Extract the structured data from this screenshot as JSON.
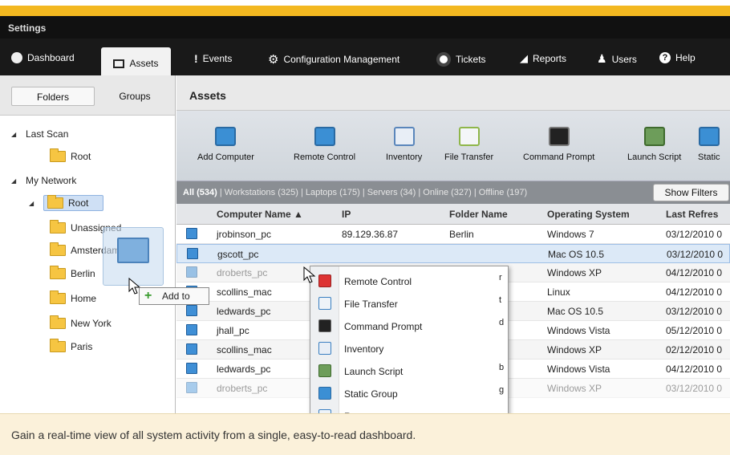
{
  "window": {
    "title": "Settings"
  },
  "nav": {
    "items": [
      {
        "label": "Dashboard",
        "icon": "dashboard-icon"
      },
      {
        "label": "Assets",
        "icon": "monitor-icon"
      },
      {
        "label": "Events",
        "icon": "exclamation-icon"
      },
      {
        "label": "Configuration Management",
        "icon": "gear-icon"
      },
      {
        "label": "Tickets",
        "icon": "lifebuoy-icon"
      },
      {
        "label": "Reports",
        "icon": "chart-icon"
      },
      {
        "label": "Users",
        "icon": "user-icon"
      },
      {
        "label": "Help",
        "icon": "help-icon"
      }
    ]
  },
  "sidebar": {
    "tabs": [
      "Folders",
      "Groups"
    ],
    "tree": {
      "last_scan": "Last Scan",
      "root1": "Root",
      "my_network": "My Network",
      "root2": "Root",
      "unassigned": "Unassigned",
      "amsterdam": "Amsterdam",
      "berlin": "Berlin",
      "home": "Home",
      "new_york": "New York",
      "paris": "Paris"
    }
  },
  "main": {
    "title": "Assets",
    "toolbar": [
      {
        "label": "Add Computer",
        "icon": "add-computer-icon"
      },
      {
        "label": "Remote Control",
        "icon": "remote-control-icon"
      },
      {
        "label": "Inventory",
        "icon": "inventory-icon"
      },
      {
        "label": "File Transfer",
        "icon": "file-transfer-icon"
      },
      {
        "label": "Command Prompt",
        "icon": "command-prompt-icon"
      },
      {
        "label": "Launch Script",
        "icon": "launch-script-icon"
      },
      {
        "label": "Static",
        "icon": "static-group-icon"
      }
    ],
    "filters": {
      "all": "All (534)",
      "workstations": "Workstations (325)",
      "laptops": "Laptops (175)",
      "servers": "Servers (34)",
      "online": "Online (327)",
      "offline": "Offline (197)",
      "show_filters": "Show Filters"
    },
    "columns": [
      "Computer Name ▲",
      "IP",
      "Folder Name",
      "Operating System",
      "Last Refres"
    ],
    "rows": [
      {
        "name": "jrobinson_pc",
        "ip": "89.129.36.87",
        "folder": "Berlin",
        "os": "Windows 7",
        "date": "03/12/2010 0"
      },
      {
        "name": "gscott_pc",
        "ip": "",
        "folder": "",
        "os": "Mac OS 10.5",
        "date": "03/12/2010 0"
      },
      {
        "name": "droberts_pc",
        "ip": "",
        "folder": "",
        "os": "Windows XP",
        "date": "04/12/2010 0"
      },
      {
        "name": "scollins_mac",
        "ip": "",
        "folder": "",
        "os": "Linux",
        "date": "04/12/2010 0"
      },
      {
        "name": "ledwards_pc",
        "ip": "",
        "folder": "",
        "os": "Mac OS 10.5",
        "date": "03/12/2010 0"
      },
      {
        "name": "jhall_pc",
        "ip": "",
        "folder": "",
        "os": "Windows Vista",
        "date": "05/12/2010 0"
      },
      {
        "name": "scollins_mac",
        "ip": "",
        "folder": "",
        "os": "Windows XP",
        "date": "02/12/2010 0"
      },
      {
        "name": "ledwards_pc",
        "ip": "",
        "folder": "",
        "os": "Windows Vista",
        "date": "04/12/2010 0"
      },
      {
        "name": "droberts_pc",
        "ip": "",
        "folder": "",
        "os": "Windows XP",
        "date": "03/12/2010 0"
      }
    ]
  },
  "context_menu": [
    {
      "label": "Remote Control",
      "shortcut": "r"
    },
    {
      "label": "File Transfer",
      "shortcut": "t"
    },
    {
      "label": "Command Prompt",
      "shortcut": "d"
    },
    {
      "label": "Inventory",
      "shortcut": ""
    },
    {
      "label": "Launch Script",
      "shortcut": "b"
    },
    {
      "label": "Static Group",
      "shortcut": "g"
    },
    {
      "label": "Rename",
      "shortcut": ""
    }
  ],
  "drag": {
    "add_to_label": "Add to"
  },
  "footer": {
    "caption": "Gain a real-time view of all system activity from a single, easy-to-read dashboard."
  }
}
